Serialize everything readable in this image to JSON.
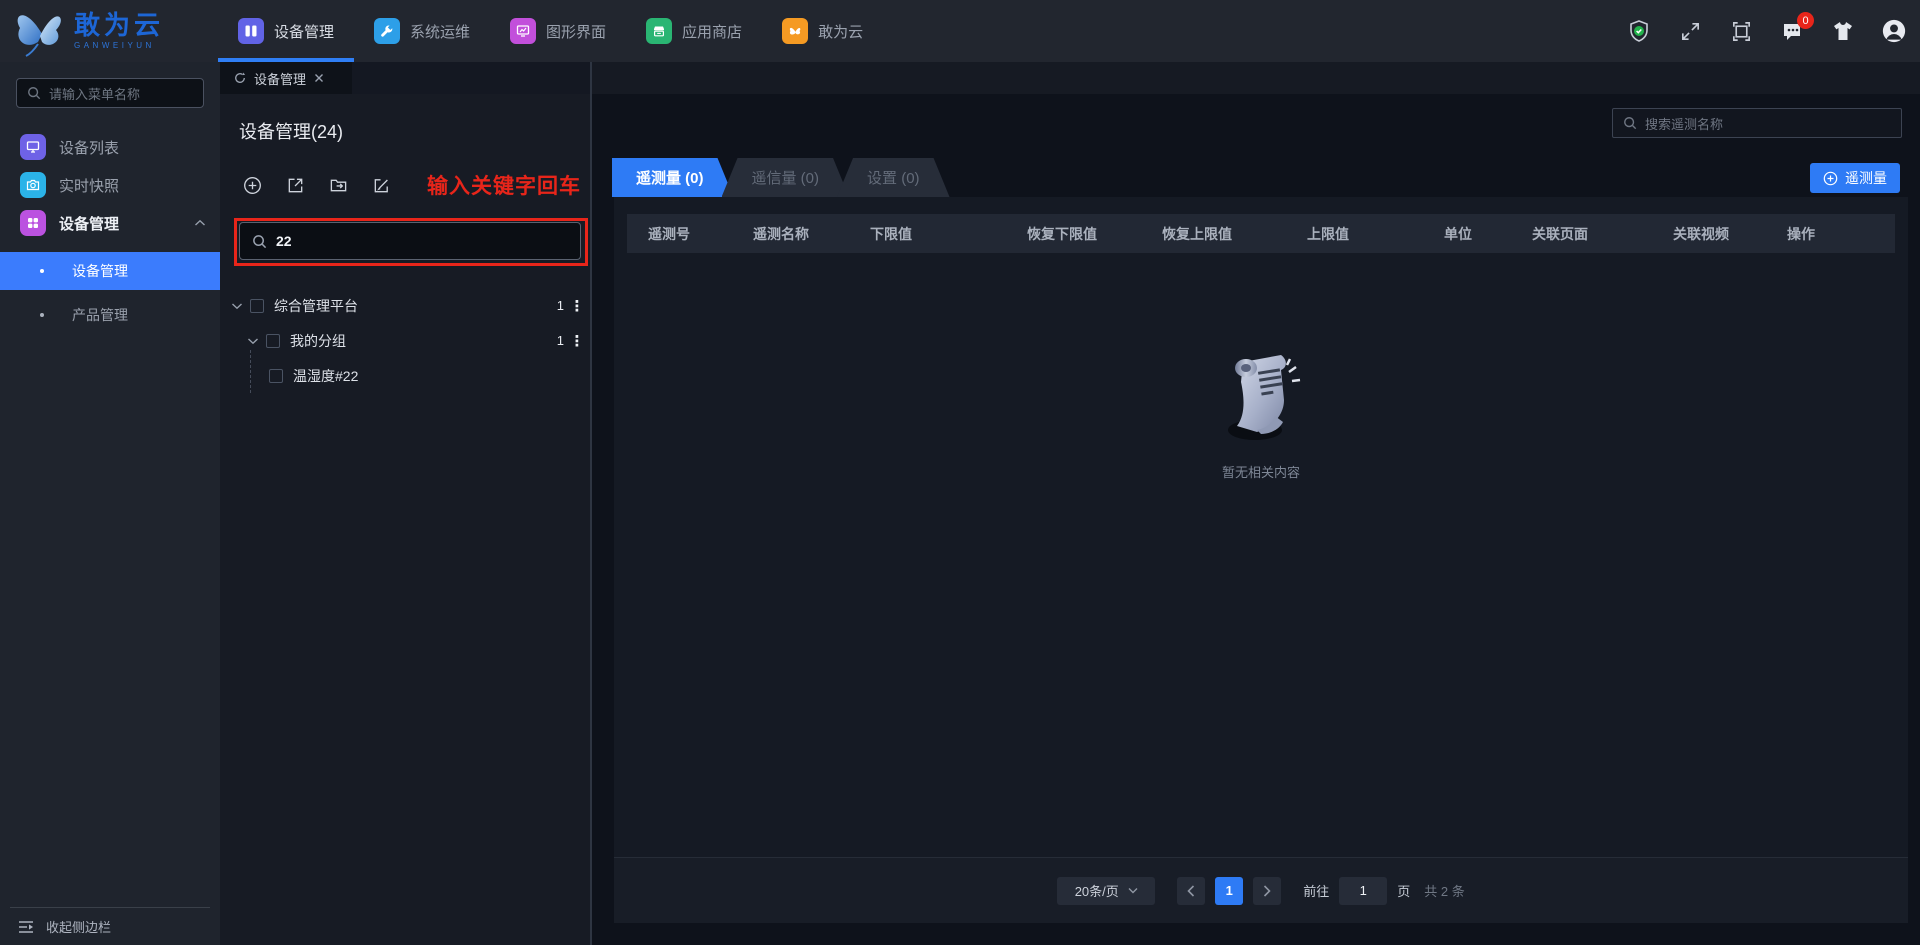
{
  "topbar": {
    "logo": {
      "title": "敢为云",
      "subtitle": "GANWEIYUN"
    },
    "nav": [
      {
        "label": "设备管理",
        "color": "#6163e6",
        "active": true
      },
      {
        "label": "系统运维",
        "color": "#2d9fe8",
        "active": false
      },
      {
        "label": "图形界面",
        "color": "#c24fdb",
        "active": false
      },
      {
        "label": "应用商店",
        "color": "#2ab573",
        "active": false
      },
      {
        "label": "敢为云",
        "color": "#f59a23",
        "active": false
      }
    ],
    "message_badge": "0"
  },
  "sidebar": {
    "search_placeholder": "请输入菜单名称",
    "items": [
      {
        "label": "设备列表",
        "color": "#6e62e6"
      },
      {
        "label": "实时快照",
        "color": "#2bb3e8"
      },
      {
        "label": "设备管理",
        "color": "#bb52e0",
        "expanded": true
      }
    ],
    "subitems": [
      {
        "label": "设备管理",
        "active": true
      },
      {
        "label": "产品管理",
        "active": false
      }
    ],
    "collapse_label": "收起侧边栏"
  },
  "tree_panel": {
    "tab_label": "设备管理",
    "title": "设备管理(24)",
    "annotation": "输入关键字回车",
    "search_value": "22",
    "tree": [
      {
        "label": "综合管理平台",
        "count": "1"
      },
      {
        "label": "我的分组",
        "count": "1"
      },
      {
        "label": "温湿度#22",
        "count": ""
      }
    ]
  },
  "content": {
    "search_placeholder": "搜索遥测名称",
    "tabs": [
      {
        "label": "遥测量 (0)",
        "active": true
      },
      {
        "label": "遥信量 (0)",
        "active": false
      },
      {
        "label": "设置 (0)",
        "active": false
      }
    ],
    "add_button_label": "遥测量",
    "table_headers": [
      "遥测号",
      "遥测名称",
      "下限值",
      "恢复下限值",
      "恢复上限值",
      "上限值",
      "单位",
      "关联页面",
      "关联视频",
      "操作"
    ],
    "empty_text": "暂无相关内容",
    "pagination": {
      "page_size": "20条/页",
      "current_page": "1",
      "goto_label": "前往",
      "goto_value": "1",
      "page_unit": "页",
      "total": "共 2 条"
    }
  },
  "colors": {
    "accent_blue": "#2e7bf5",
    "sidebar_active_blue": "#3b7cfd",
    "annotation_red": "#e8251a",
    "topbar_bg": "#22262f",
    "sidebar_bg": "#1f242d",
    "panel_bg": "#171b24",
    "card_bg": "#151a24",
    "table_header_bg": "#222834"
  }
}
